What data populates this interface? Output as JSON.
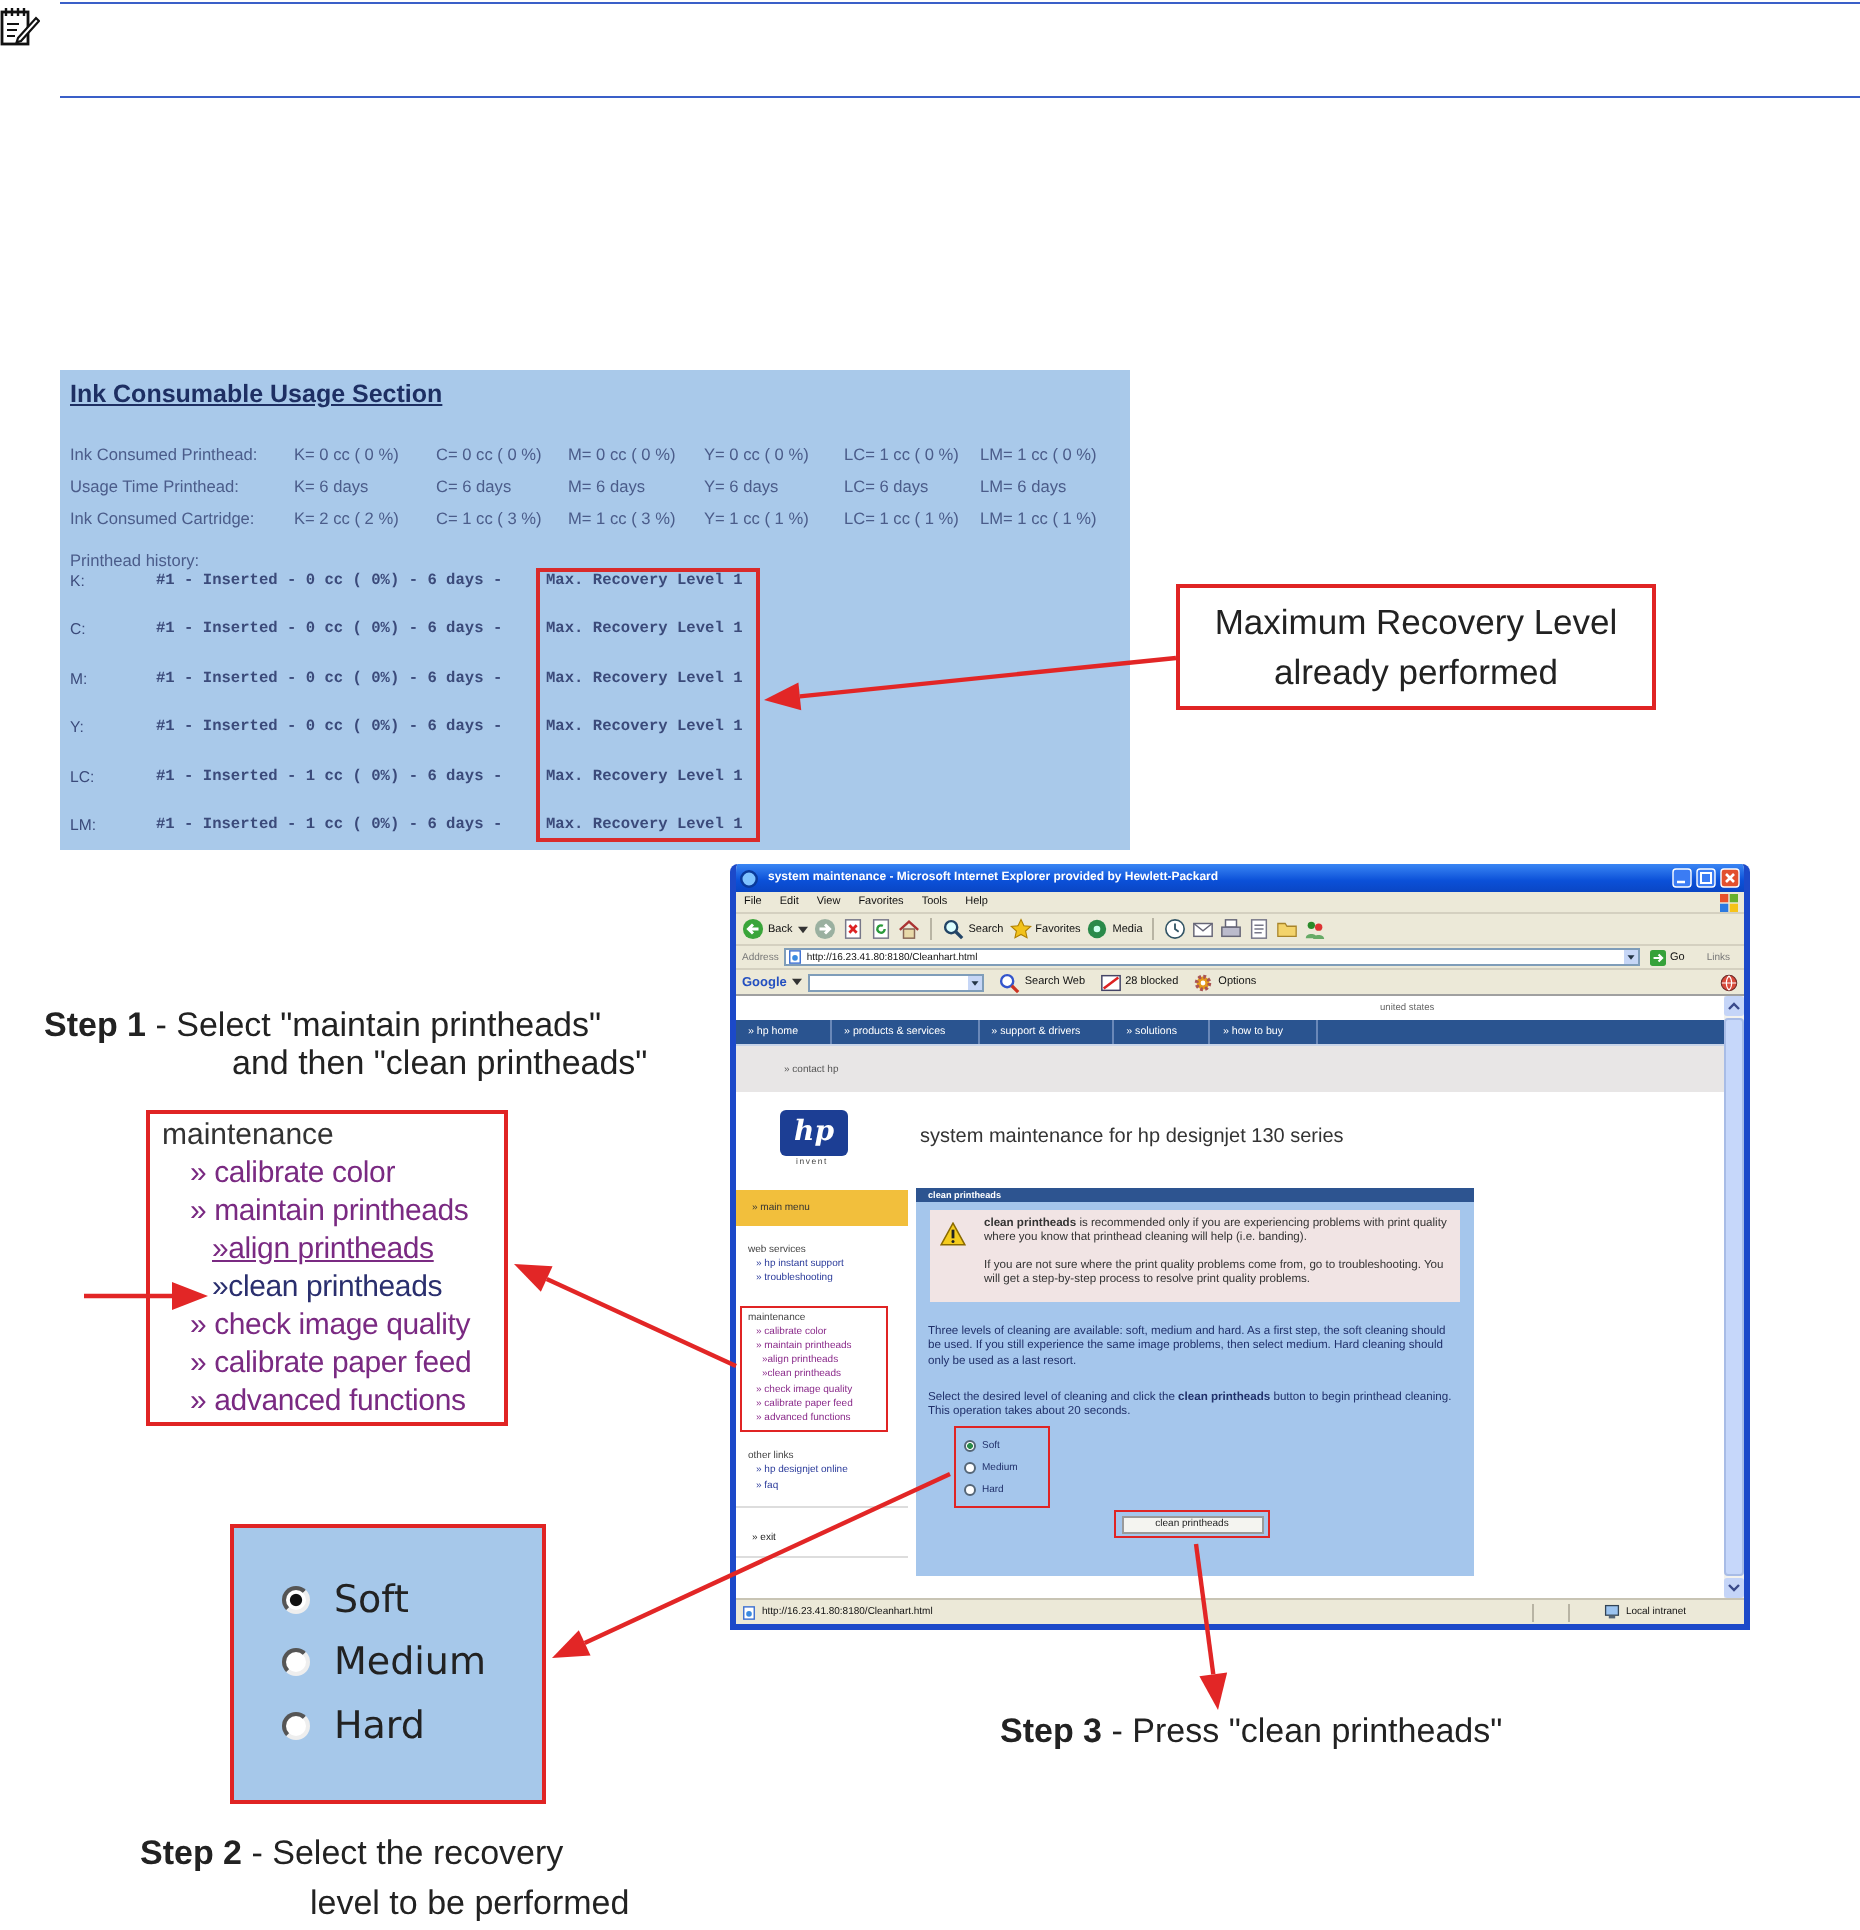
{
  "ink_usage": {
    "title": "Ink Consumable Usage Section",
    "rows": [
      {
        "label": "Ink Consumed Printhead:",
        "values": [
          "K= 0 cc ( 0 %)",
          "C= 0 cc ( 0 %)",
          "M= 0 cc ( 0 %)",
          "Y= 0 cc ( 0 %)",
          "LC= 1 cc ( 0 %)",
          "LM= 1 cc ( 0 %)"
        ]
      },
      {
        "label": "Usage Time Printhead:",
        "values": [
          "K= 6 days",
          "C= 6 days",
          "M= 6 days",
          "Y= 6 days",
          "LC= 6 days",
          "LM= 6 days"
        ]
      },
      {
        "label": "Ink Consumed Cartridge:",
        "values": [
          "K= 2 cc ( 2 %)",
          "C= 1 cc ( 3 %)",
          "M= 1 cc ( 3 %)",
          "Y= 1 cc ( 1 %)",
          "LC= 1 cc ( 1 %)",
          "LM= 1 cc ( 1 %)"
        ]
      }
    ],
    "history_title": "Printhead history:",
    "history": [
      {
        "ink": "K:",
        "detail": "#1 - Inserted - 0 cc ( 0%) - 6 days -",
        "recovery": "Max. Recovery Level 1"
      },
      {
        "ink": "C:",
        "detail": "#1 - Inserted - 0 cc ( 0%) - 6 days -",
        "recovery": "Max. Recovery Level 1"
      },
      {
        "ink": "M:",
        "detail": "#1 - Inserted - 0 cc ( 0%) - 6 days -",
        "recovery": "Max. Recovery Level 1"
      },
      {
        "ink": "Y:",
        "detail": "#1 - Inserted - 0 cc ( 0%) - 6 days -",
        "recovery": "Max. Recovery Level 1"
      },
      {
        "ink": "LC:",
        "detail": "#1 - Inserted - 1 cc ( 0%) - 6 days -",
        "recovery": "Max. Recovery Level 1"
      },
      {
        "ink": "LM:",
        "detail": "#1 - Inserted - 1 cc ( 0%) - 6 days -",
        "recovery": "Max. Recovery Level 1"
      }
    ],
    "recovery_highlighted": true
  },
  "callout": {
    "text": "Maximum Recovery Level\nalready performed"
  },
  "step_1": {
    "text": "**Step 1** - Select \"maintain printheads\"\nand then \"clean printheads\""
  },
  "maintenance_menu": {
    "heading": "maintenance",
    "items": [
      {
        "label": "» calibrate color",
        "selected": false,
        "hovered": false
      },
      {
        "label": "» maintain printheads",
        "selected": false,
        "hovered": false,
        "children": [
          {
            "label": "»align printheads",
            "selected": false,
            "hovered": true
          },
          {
            "label": "»clean printheads",
            "selected": true,
            "hovered": false
          }
        ]
      },
      {
        "label": "» check image quality",
        "selected": false,
        "hovered": false
      },
      {
        "label": "» calibrate paper feed",
        "selected": false,
        "hovered": false
      },
      {
        "label": "» advanced functions",
        "selected": false,
        "hovered": false
      }
    ]
  },
  "browser": {
    "title": "system maintenance - Microsoft Internet Explorer provided by Hewlett-Packard",
    "menu": [
      "File",
      "Edit",
      "View",
      "Favorites",
      "Tools",
      "Help"
    ],
    "toolbar": [
      {
        "kind": "back",
        "label": "Back"
      },
      {
        "kind": "forward"
      },
      {
        "kind": "stop"
      },
      {
        "kind": "refresh"
      },
      {
        "kind": "home"
      },
      {
        "kind": "search",
        "label": "Search"
      },
      {
        "kind": "favorites",
        "label": "Favorites"
      },
      {
        "kind": "media",
        "label": "Media"
      },
      {
        "kind": "history"
      },
      {
        "kind": "mail"
      },
      {
        "kind": "print"
      },
      {
        "kind": "edit"
      },
      {
        "kind": "folder"
      },
      {
        "kind": "messenger"
      }
    ],
    "address": {
      "label": "Address",
      "value": "http://16.23.41.80:8180/Cleanhart.html",
      "go": "Go",
      "links": "Links"
    },
    "google": {
      "logo": "Google",
      "buttons": [
        {
          "kind": "search",
          "label": "Search Web"
        },
        {
          "kind": "blocked",
          "label": "28 blocked"
        },
        {
          "kind": "options",
          "label": "Options"
        }
      ]
    },
    "region": "united states",
    "nav": [
      "» hp home",
      "» products & services",
      "» support & drivers",
      "» solutions",
      "» how to buy"
    ],
    "contact": "» contact hp",
    "logo": {
      "mark": "hp",
      "tagline": "invent"
    },
    "heading": "system maintenance for hp designjet 130 series",
    "sidebar": {
      "main_menu": "» main menu",
      "groups": [
        {
          "heading": "web services",
          "highlighted": false,
          "links": [
            {
              "label": "» hp instant support",
              "visited": false
            },
            {
              "label": "» troubleshooting",
              "visited": false
            }
          ]
        },
        {
          "heading": "maintenance",
          "highlighted": true,
          "links": [
            {
              "label": "» calibrate color",
              "visited": true
            },
            {
              "label": "» maintain printheads",
              "visited": true,
              "children": [
                {
                  "label": "»align printheads",
                  "visited": true
                },
                {
                  "label": "»clean printheads",
                  "visited": true
                }
              ]
            },
            {
              "label": "» check image quality",
              "visited": true
            },
            {
              "label": "» calibrate paper feed",
              "visited": true
            },
            {
              "label": "» advanced functions",
              "visited": true
            }
          ]
        },
        {
          "heading": "other links",
          "highlighted": false,
          "links": [
            {
              "label": "» hp designjet online",
              "visited": false
            },
            {
              "label": "» faq",
              "visited": false
            }
          ]
        }
      ],
      "exit": "» exit"
    },
    "panel": {
      "title": "clean printheads",
      "warning": [
        "**clean printheads** is recommended only if you are experiencing problems with print quality where you know that printhead cleaning will help (i.e. banding).",
        "If you are not sure where the print quality problems come from, go to troubleshooting. You will get a step-by-step process to resolve print quality problems."
      ],
      "paragraphs": [
        "Three levels of cleaning are available: soft, medium and hard. As a first step, the soft cleaning should be used. If you still experience the same image problems, then select medium. Hard cleaning should only be used as a last resort.",
        "Select the desired level of cleaning and click the **clean printheads** button to begin printhead cleaning. This operation takes about 20 seconds."
      ],
      "options": [
        {
          "label": "Soft",
          "selected": true
        },
        {
          "label": "Medium",
          "selected": false
        },
        {
          "label": "Hard",
          "selected": false
        }
      ],
      "options_highlighted": true,
      "button": "clean printheads",
      "button_highlighted": true
    },
    "status": {
      "url": "http://16.23.41.80:8180/Cleanhart.html",
      "zone": "Local intranet"
    }
  },
  "step_2_options": [
    {
      "label": "Soft",
      "selected": true
    },
    {
      "label": "Medium",
      "selected": false
    },
    {
      "label": "Hard",
      "selected": false
    }
  ],
  "step_3": {
    "text": "**Step 3** - Press \"clean printheads\""
  },
  "step_2": {
    "text": "**Step 2** - Select the recovery\nlevel to be performed"
  }
}
